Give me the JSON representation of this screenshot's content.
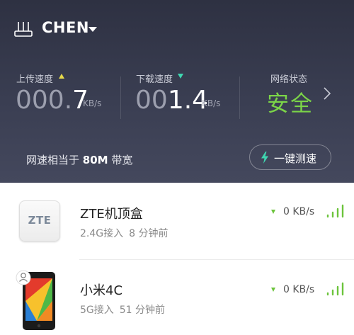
{
  "header": {
    "router_name": "CHEN",
    "upload": {
      "label": "上传速度",
      "value_dim": "000.",
      "value_bright": "7",
      "unit": "KB/s"
    },
    "download": {
      "label": "下载速度",
      "value_dim": "00",
      "value_bright": "1.4",
      "unit": "KB/s"
    },
    "network_status": {
      "label": "网络状态",
      "value": "安全"
    },
    "bandwidth": {
      "prefix": "网速相当于",
      "amount": "80M",
      "suffix": "带宽"
    },
    "speed_test_label": "一键测速"
  },
  "colors": {
    "header_bg": "#363a4d",
    "safe_green": "#7bd448",
    "upload_arrow": "#e6d94a",
    "download_arrow": "#3fd6b0",
    "signal_green": "#6cc43c"
  },
  "devices": [
    {
      "name": "ZTE机顶盒",
      "logo_text": "ZTE",
      "band": "2.4G接入",
      "last_seen": "8 分钟前",
      "speed": "0 KB/s",
      "icon": "zte-logo"
    },
    {
      "name": "小米4C",
      "band": "5G接入",
      "last_seen": "51 分钟前",
      "speed": "0 KB/s",
      "icon": "phone-thumbnail"
    }
  ]
}
